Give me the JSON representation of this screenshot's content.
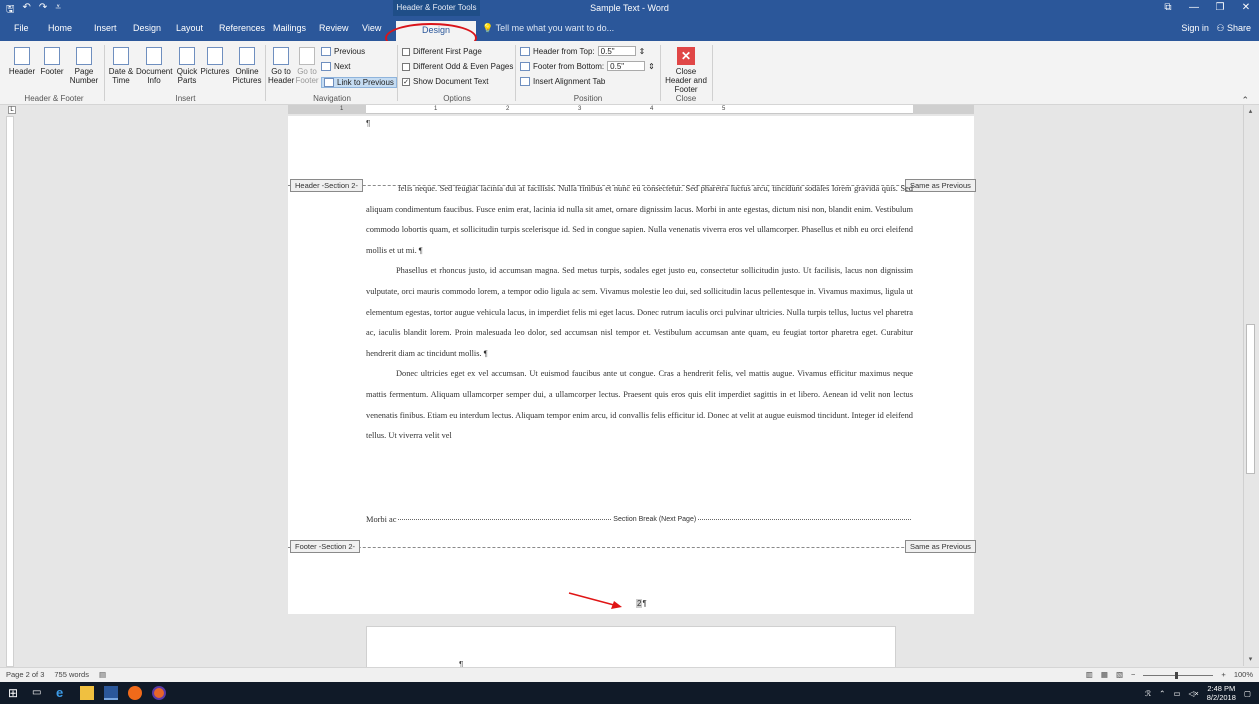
{
  "window": {
    "title": "Sample Text - Word",
    "context_tab_group": "Header & Footer Tools",
    "controls": [
      "⧉",
      "—",
      "❐",
      "✕"
    ]
  },
  "tabs": [
    "File",
    "Home",
    "Insert",
    "Design",
    "Layout",
    "References",
    "Mailings",
    "Review",
    "View",
    "Design"
  ],
  "tell_me": "Tell me what you want to do...",
  "sign_in": "Sign in",
  "share": "Share",
  "ribbon": {
    "header_footer": {
      "header": "Header",
      "footer": "Footer",
      "page_number": "Page Number",
      "group_label": "Header & Footer"
    },
    "insert": {
      "date_time": "Date & Time",
      "doc_info": "Document Info",
      "quick_parts": "Quick Parts",
      "pictures": "Pictures",
      "online_pictures": "Online Pictures",
      "group_label": "Insert"
    },
    "navigation": {
      "go_to_header": "Go to Header",
      "go_to_footer": "Go to Footer",
      "previous": "Previous",
      "next": "Next",
      "link_to_previous": "Link to Previous",
      "group_label": "Navigation"
    },
    "options": {
      "different_first_page": "Different First Page",
      "different_odd_even": "Different Odd & Even Pages",
      "show_document_text": "Show Document Text",
      "group_label": "Options"
    },
    "position": {
      "header_from_top": "Header from Top:",
      "header_from_top_value": "0.5\"",
      "footer_from_bottom": "Footer from Bottom:",
      "footer_from_bottom_value": "0.5\"",
      "insert_alignment_tab": "Insert Alignment Tab",
      "group_label": "Position"
    },
    "close": {
      "close_header_footer": "Close Header and Footer",
      "group_label": "Close"
    }
  },
  "ruler": {
    "numbers": [
      "1",
      "1",
      "2",
      "3",
      "4",
      "5"
    ]
  },
  "document": {
    "para_mark": "¶",
    "header_tag": "Header -Section 2-",
    "footer_tag": "Footer -Section 2-",
    "same_as_previous": "Same as Previous",
    "section_break": "Section Break (Next Page)",
    "page_number": "2",
    "paragraphs": [
      "felis neque. Sed feugiat lacinia dui at facilisis. Nulla finibus et nunc eu consectetur. Sed pharetra luctus arcu, tincidunt sodales lorem gravida quis. Sed aliquam condimentum faucibus. Fusce enim erat, lacinia id nulla sit amet, ornare dignissim lacus. Morbi in ante egestas, dictum nisi non, blandit enim. Vestibulum commodo lobortis quam, et sollicitudin turpis scelerisque id. Sed in congue sapien. Nulla venenatis viverra eros vel ullamcorper. Phasellus et nibh eu orci eleifend mollis et ut mi. ¶",
      "Phasellus et rhoncus justo, id accumsan magna. Sed metus turpis, sodales eget justo eu, consectetur sollicitudin justo. Ut facilisis, lacus non dignissim vulputate, orci mauris commodo lorem, a tempor odio ligula ac sem. Vivamus molestie leo dui, sed sollicitudin lacus pellentesque in. Vivamus maximus, ligula ut elementum egestas, tortor augue vehicula lacus, in imperdiet felis mi eget lacus. Donec rutrum iaculis orci pulvinar ultricies. Nulla turpis tellus, luctus vel pharetra ac, iaculis blandit lorem. Proin malesuada leo dolor, sed accumsan nisl tempor et. Vestibulum accumsan ante quam, eu feugiat tortor pharetra eget. Curabitur hendrerit diam ac tincidunt mollis. ¶",
      "Donec ultricies eget ex vel accumsan. Ut euismod faucibus ante ut congue. Cras a hendrerit felis, vel mattis augue. Vivamus efficitur maximus neque mattis fermentum. Aliquam ullamcorper semper dui, a ullamcorper lectus. Praesent quis eros quis elit imperdiet sagittis in et libero. Aenean id velit non lectus venenatis finibus. Etiam eu interdum lectus. Aliquam tempor enim arcu, id convallis felis efficitur id. Donec at velit at augue euismod tincidunt. Integer id eleifend tellus. Ut viverra velit vel"
    ],
    "last_fragment": "Morbi ac"
  },
  "status": {
    "page": "Page 2 of 3",
    "words": "755 words",
    "zoom": "100%"
  },
  "taskbar": {
    "time": "2:48 PM",
    "date": "8/2/2018"
  },
  "colors": {
    "word_blue": "#2b579a",
    "annotation_red": "#d9141a"
  }
}
